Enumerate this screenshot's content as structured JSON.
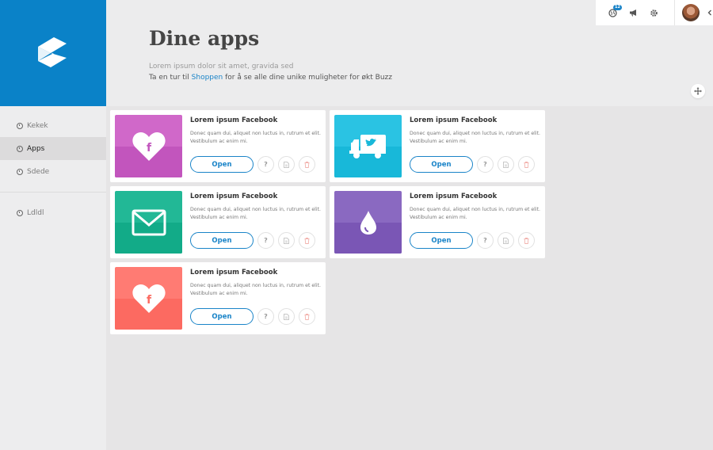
{
  "header": {
    "title": "Dine apps",
    "subtitle": "Lorem ipsum dolor sit amet, gravida sed",
    "tagline_prefix": "Ta en tur til ",
    "tagline_link": "Shoppen",
    "tagline_suffix": " for å se alle dine unike muligheter for økt Buzz"
  },
  "topbar": {
    "notification_count": "12"
  },
  "sidebar": {
    "items": [
      {
        "label": "Kekek"
      },
      {
        "label": "Apps"
      },
      {
        "label": "Sdede"
      },
      {
        "label": "Ldldl"
      }
    ]
  },
  "cards": [
    {
      "title": "Lorem ipsum Facebook",
      "desc": "Donec quam dui, aliquet non luctus in, rutrum et elit. Vestibulum ac enim mi.",
      "open": "Open",
      "help": "?",
      "icon": "facebook-heart-icon",
      "color": "#d068c9",
      "dark": "#c255bd"
    },
    {
      "title": "Lorem ipsum Facebook",
      "desc": "Donec quam dui, aliquet non luctus in, rutrum et elit. Vestibulum ac enim mi.",
      "open": "Open",
      "help": "?",
      "icon": "twitter-truck-icon",
      "color": "#2ac3e3",
      "dark": "#18b8d9"
    },
    {
      "title": "Lorem ipsum Facebook",
      "desc": "Donec quam dui, aliquet non luctus in, rutrum et elit. Vestibulum ac enim mi.",
      "open": "Open",
      "help": "?",
      "icon": "envelope-icon",
      "color": "#22b896",
      "dark": "#12ab88"
    },
    {
      "title": "Lorem ipsum Facebook",
      "desc": "Donec quam dui, aliquet non luctus in, rutrum et elit. Vestibulum ac enim mi.",
      "open": "Open",
      "help": "?",
      "icon": "drop-icon",
      "color": "#8a69c1",
      "dark": "#7a56b5"
    },
    {
      "title": "Lorem ipsum Facebook",
      "desc": "Donec quam dui, aliquet non luctus in, rutrum et elit. Vestibulum ac enim mi.",
      "open": "Open",
      "help": "?",
      "icon": "facebook-heart-icon",
      "color": "#ff7b73",
      "dark": "#fc6a61"
    }
  ]
}
